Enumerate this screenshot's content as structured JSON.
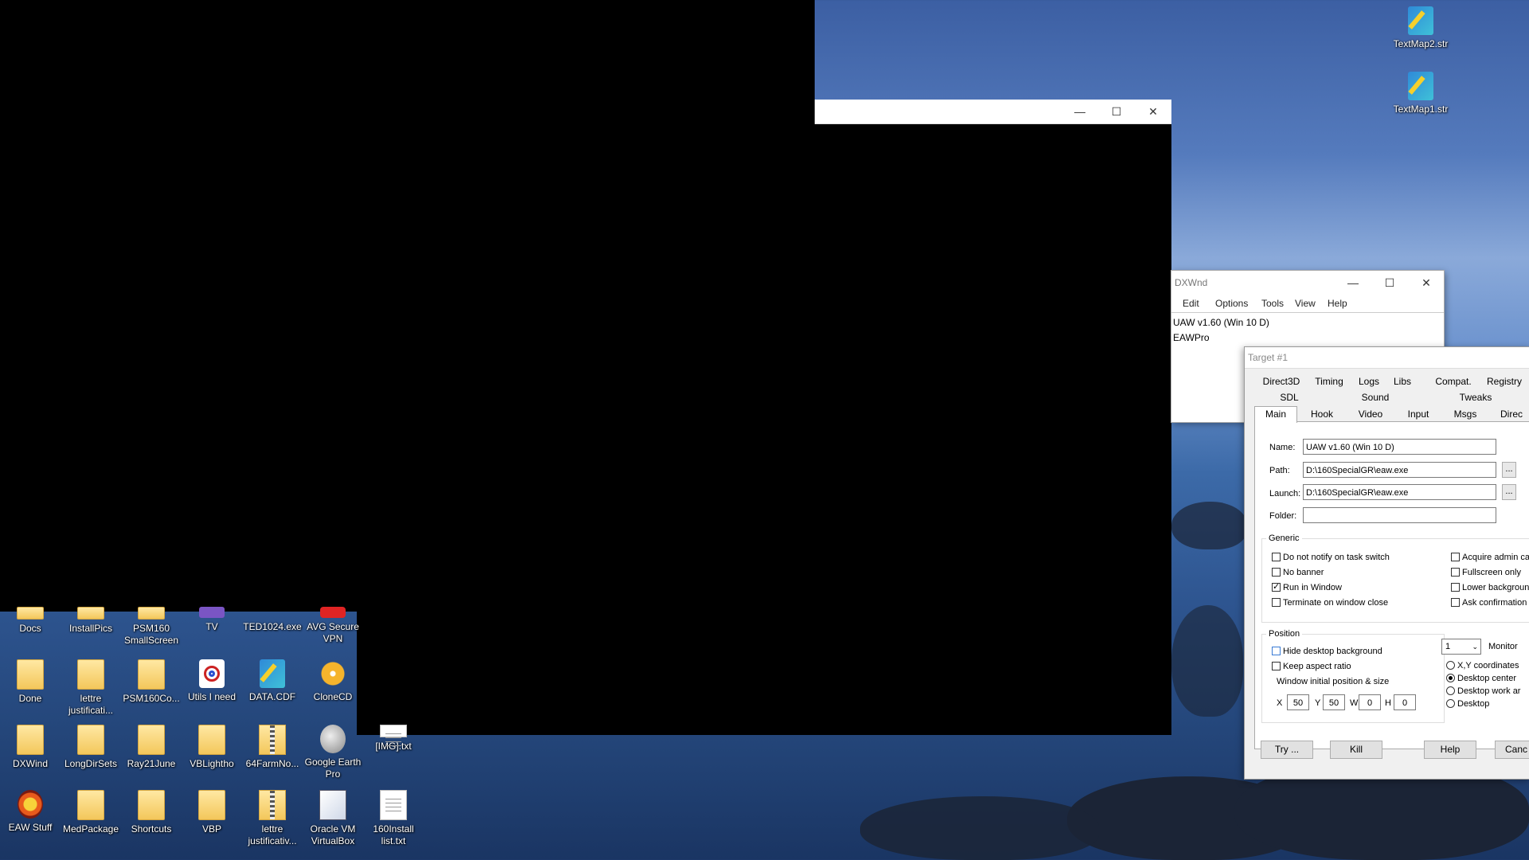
{
  "game_window": {
    "minimize": "—",
    "maximize": "☐",
    "close": "✕"
  },
  "desktop_icons": [
    {
      "label": "Docs"
    },
    {
      "label": "InstallPics"
    },
    {
      "label": "PSM160 SmallScreen"
    },
    {
      "label": "TV"
    },
    {
      "label": "TED1024.exe"
    },
    {
      "label": "AVG Secure VPN"
    },
    {
      "label": "Done"
    },
    {
      "label": "lettre justificati..."
    },
    {
      "label": "PSM160Co..."
    },
    {
      "label": "Utils I need"
    },
    {
      "label": "DATA.CDF"
    },
    {
      "label": "CloneCD"
    },
    {
      "label": "DXWind"
    },
    {
      "label": "LongDirSets"
    },
    {
      "label": "Ray21June"
    },
    {
      "label": "VBLightho"
    },
    {
      "label": "64FarmNo..."
    },
    {
      "label": "Google Earth Pro"
    },
    {
      "label": "[IMG].txt"
    },
    {
      "label": "EAW Stuff"
    },
    {
      "label": "MedPackage"
    },
    {
      "label": "Shortcuts"
    },
    {
      "label": "VBP"
    },
    {
      "label": "lettre justificativ..."
    },
    {
      "label": "Oracle VM VirtualBox"
    },
    {
      "label": "160Install list.txt"
    },
    {
      "label": "TextMap2.str"
    },
    {
      "label": "TextMap1.str"
    }
  ],
  "dxwnd": {
    "title": "DXWnd",
    "menu": [
      "Edit",
      "Options",
      "Tools",
      "View",
      "Help"
    ],
    "list": [
      "UAW v1.60 (Win 10 D)",
      "EAWPro"
    ],
    "minimize": "—",
    "maximize": "☐",
    "close": "✕"
  },
  "target": {
    "title": "Target #1",
    "tabs_row1": [
      "Direct3D",
      "Timing",
      "Logs",
      "Libs",
      "Compat.",
      "Registry"
    ],
    "tabs_row2": [
      "SDL",
      "Sound",
      "Tweaks"
    ],
    "tabs_row3": [
      "Main",
      "Hook",
      "Video",
      "Input",
      "Msgs",
      "Direc"
    ],
    "name_label": "Name:",
    "name_value": "UAW v1.60 (Win 10 D)",
    "path_label": "Path:",
    "path_value": "D:\\160SpecialGR\\eaw.exe",
    "launch_label": "Launch:",
    "launch_value": "D:\\160SpecialGR\\eaw.exe",
    "folder_label": "Folder:",
    "folder_value": "",
    "browse": "...",
    "generic": {
      "title": "Generic",
      "left": [
        {
          "label": "Do not notify on task switch",
          "checked": false
        },
        {
          "label": "No banner",
          "checked": false
        },
        {
          "label": "Run in Window",
          "checked": true
        },
        {
          "label": "Terminate on window close",
          "checked": false
        }
      ],
      "right": [
        {
          "label": "Acquire admin ca",
          "checked": false
        },
        {
          "label": "Fullscreen only",
          "checked": false
        },
        {
          "label": "Lower backgroun",
          "checked": false
        },
        {
          "label": "Ask confirmation",
          "checked": false
        }
      ]
    },
    "position": {
      "title": "Position",
      "hide_desktop": "Hide desktop background",
      "keep_aspect": "Keep aspect ratio",
      "initial": "Window initial position & size",
      "x_label": "X",
      "x": "50",
      "y_label": "Y",
      "y": "50",
      "w_label": "W",
      "w": "0",
      "h_label": "H",
      "h": "0",
      "monitor_value": "1",
      "monitor_label": "Monitor",
      "radios": [
        {
          "label": "X,Y coordinates",
          "selected": false
        },
        {
          "label": "Desktop center",
          "selected": true
        },
        {
          "label": "Desktop work ar",
          "selected": false
        },
        {
          "label": "Desktop",
          "selected": false
        }
      ]
    },
    "buttons": {
      "try": "Try ...",
      "kill": "Kill",
      "help": "Help",
      "cancel": "Canc"
    }
  }
}
